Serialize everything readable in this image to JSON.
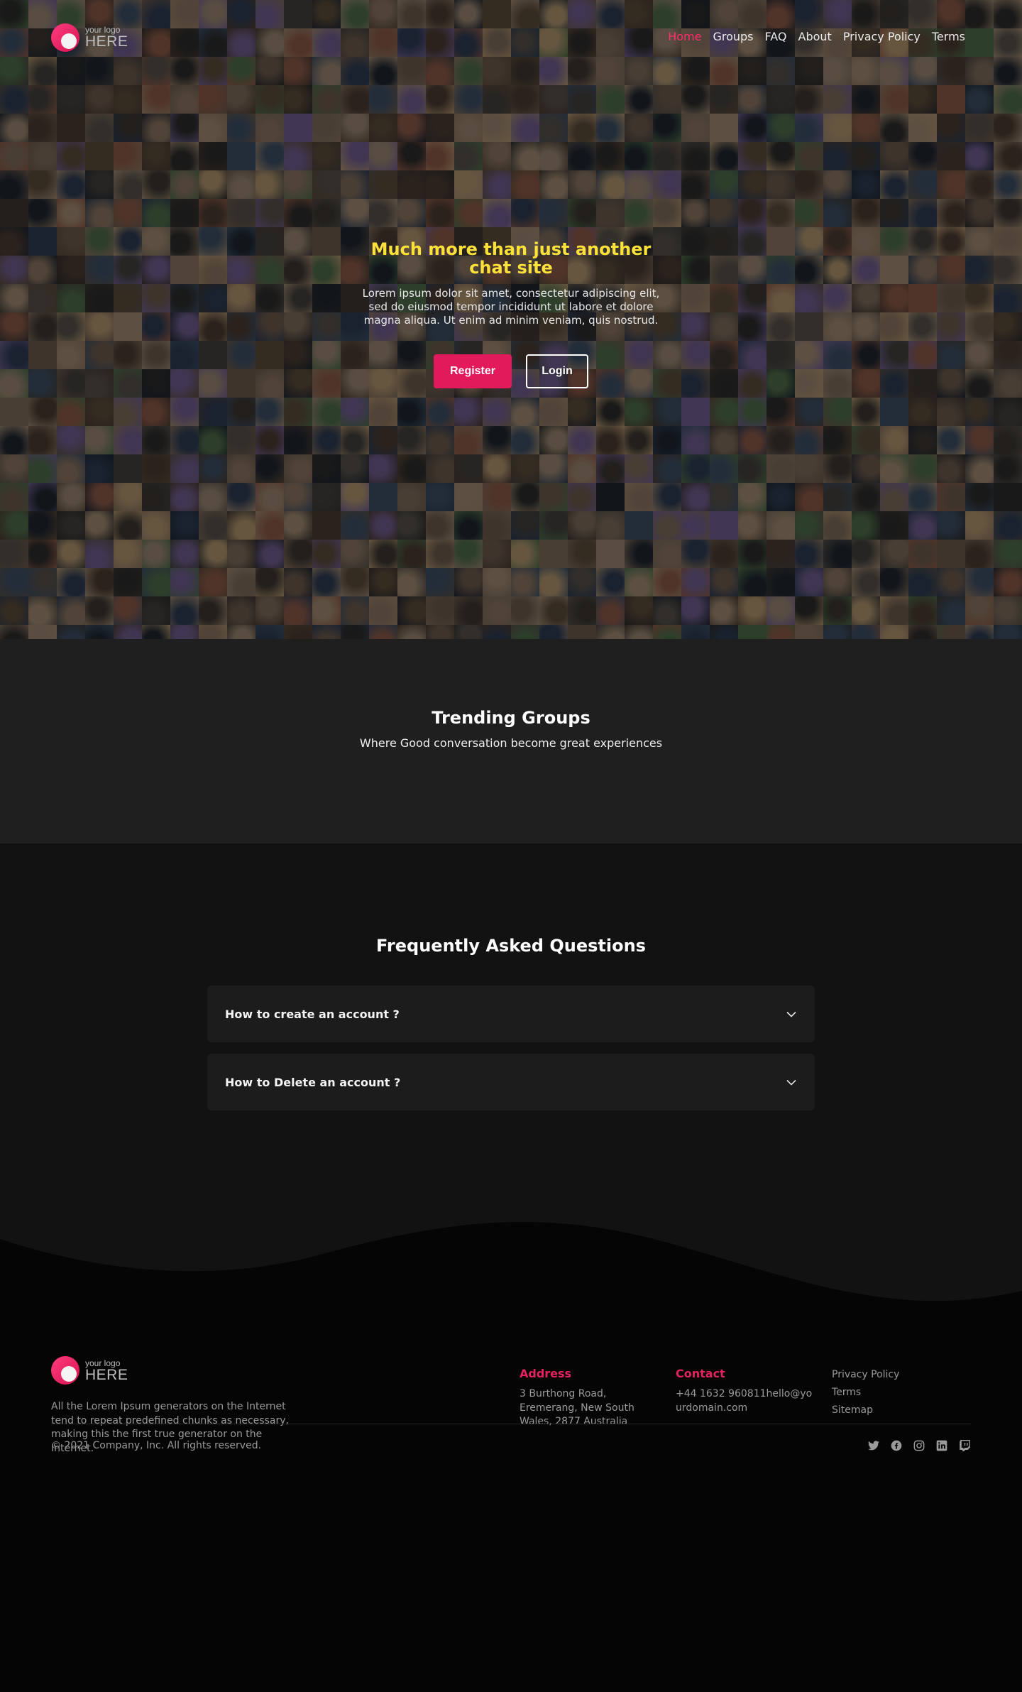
{
  "logo": {
    "small": "your logo",
    "big": "HERE"
  },
  "nav": {
    "items": [
      {
        "label": "Home",
        "active": true
      },
      {
        "label": "Groups",
        "active": false
      },
      {
        "label": "FAQ",
        "active": false
      },
      {
        "label": "About",
        "active": false
      },
      {
        "label": "Privacy Policy",
        "active": false
      },
      {
        "label": "Terms",
        "active": false
      }
    ]
  },
  "hero": {
    "title": "Much more than just another chat site",
    "text": "Lorem ipsum dolor sit amet, consectetur adipiscing elit, sed do eiusmod tempor incididunt ut labore et dolore magna aliqua. Ut enim ad minim veniam, quis nostrud.",
    "register_label": "Register",
    "login_label": "Login"
  },
  "trending": {
    "title": "Trending Groups",
    "subtitle": "Where Good conversation become great experiences"
  },
  "faq": {
    "title": "Frequently Asked Questions",
    "items": [
      {
        "question": "How to create an account ?"
      },
      {
        "question": "How to Delete an account ?"
      }
    ]
  },
  "footer": {
    "description": "All the Lorem Ipsum generators on the Internet tend to repeat predefined chunks as necessary, making this the first true generator on the Internet.",
    "address_title": "Address",
    "address": "3 Burthong Road, Eremerang, New South Wales, 2877 Australia",
    "contact_title": "Contact",
    "contact": "+44 1632 960811hello@yourdomain.com",
    "links": [
      "Privacy Policy",
      "Terms",
      "Sitemap"
    ],
    "copyright": "© 2021 Company, Inc. All rights reserved.",
    "socials": [
      "twitter-icon",
      "facebook-icon",
      "instagram-icon",
      "linkedin-icon",
      "twitch-icon"
    ]
  },
  "colors": {
    "accent": "#e2195b",
    "hero_title": "#fbe13a",
    "trending_bg": "#1f1f1f",
    "faq_bg": "#121212",
    "footer_bg": "#050505"
  }
}
